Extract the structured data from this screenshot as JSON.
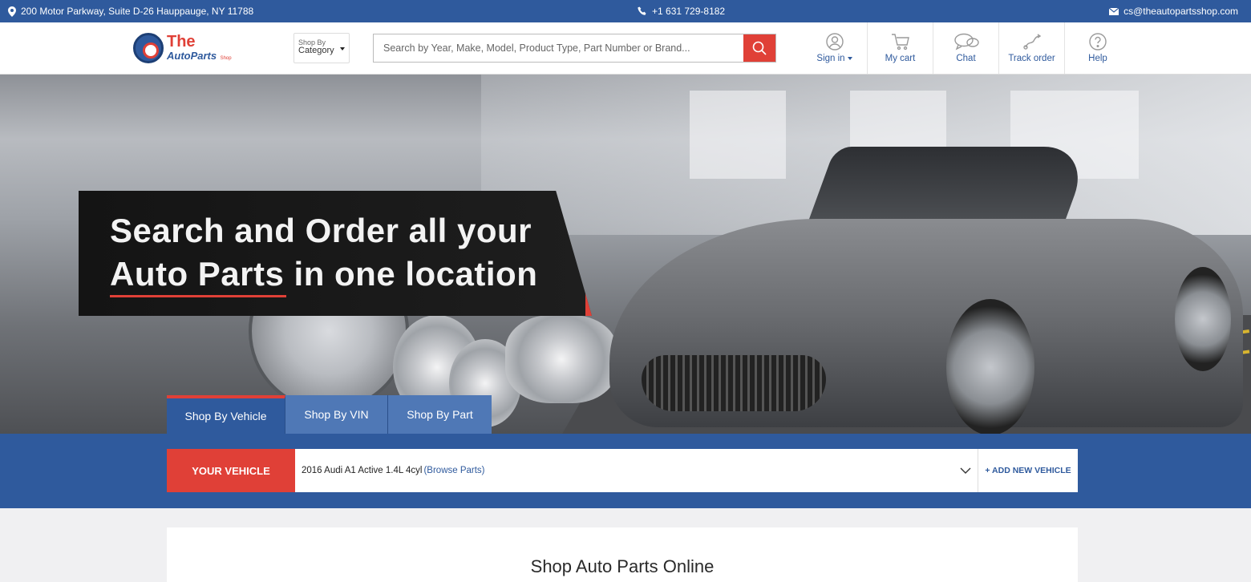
{
  "topbar": {
    "address": "200 Motor Parkway, Suite D-26 Hauppauge, NY 11788",
    "phone": "+1 631 729-8182",
    "email": "cs@theautopartsshop.com"
  },
  "logo": {
    "the": "The",
    "name": "AutoParts",
    "suffix": "Shop"
  },
  "category_select": {
    "small_label": "Shop By",
    "value": "Category"
  },
  "search": {
    "placeholder": "Search by Year, Make, Model, Product Type, Part Number or Brand..."
  },
  "nav": {
    "signin": "Sign in",
    "cart": "My cart",
    "chat": "Chat",
    "track": "Track order",
    "help": "Help"
  },
  "hero": {
    "line1": "Search and Order all your",
    "line2": "Auto Parts in one location"
  },
  "tabs": [
    "Shop By Vehicle",
    "Shop By VIN",
    "Shop By Part"
  ],
  "vehicle": {
    "label": "YOUR VEHICLE",
    "selected": "2016 Audi A1 Active 1.4L 4cyl",
    "browse": "(Browse Parts)",
    "add": "+ ADD NEW VEHICLE"
  },
  "content": {
    "title": "Shop Auto Parts Online"
  },
  "colors": {
    "brand_blue": "#2f5a9d",
    "accent_red": "#e04037",
    "tab_blue": "#4f78b6"
  }
}
